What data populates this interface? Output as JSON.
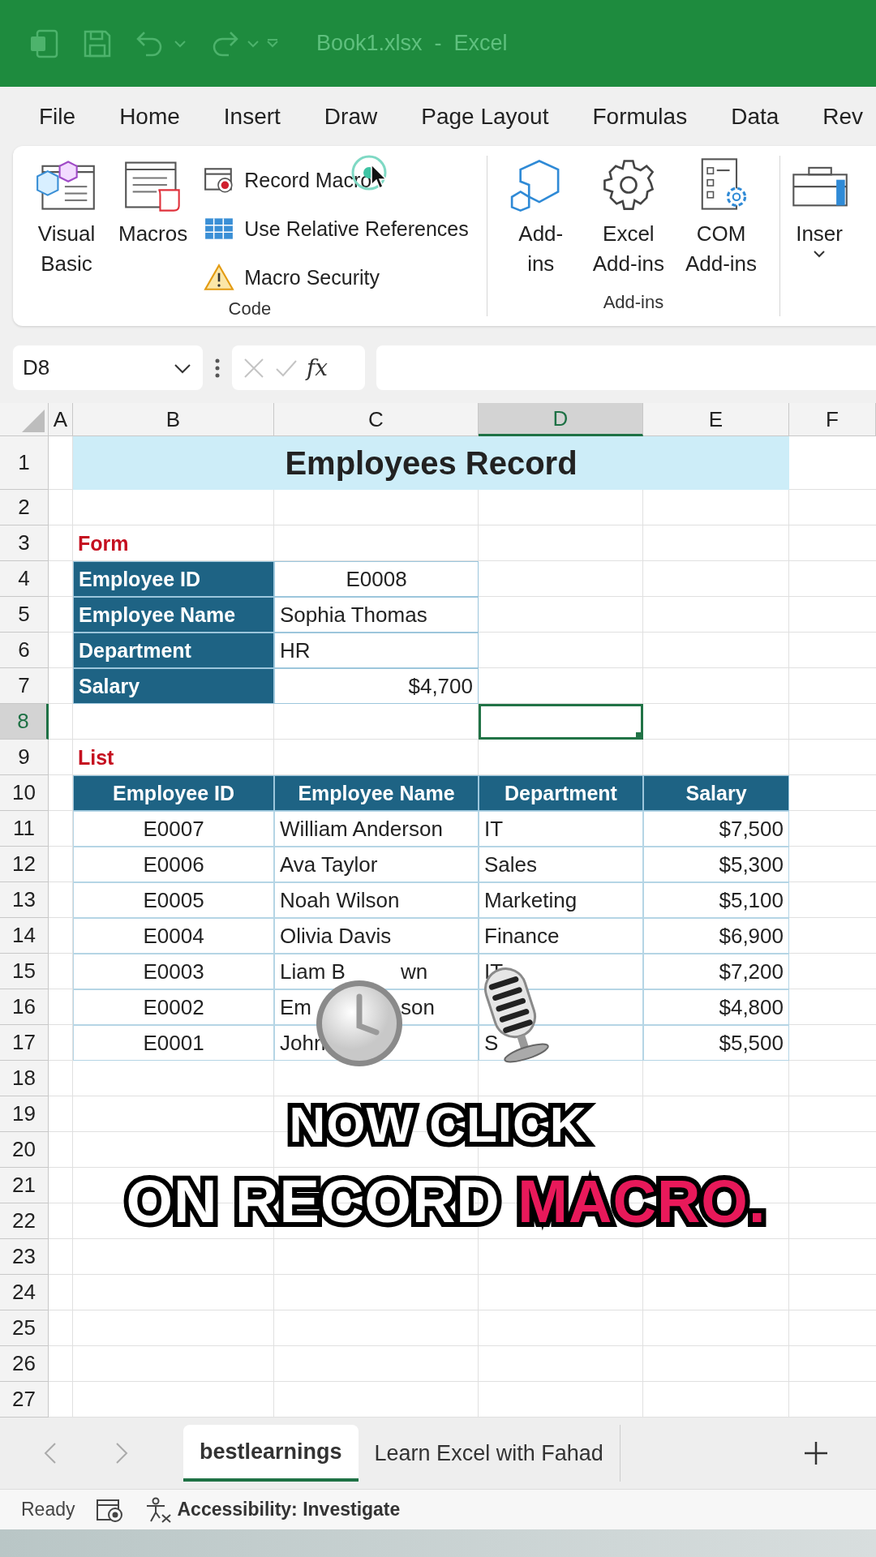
{
  "window": {
    "title": "Book1.xlsx  -  Excel"
  },
  "menu_tabs": [
    {
      "label": "File"
    },
    {
      "label": "Home"
    },
    {
      "label": "Insert"
    },
    {
      "label": "Draw"
    },
    {
      "label": "Page Layout"
    },
    {
      "label": "Formulas"
    },
    {
      "label": "Data"
    },
    {
      "label": "Rev"
    }
  ],
  "ribbon": {
    "groups": [
      {
        "label": "Code",
        "large_buttons": [
          {
            "kind": "visual-basic",
            "lines": [
              "Visual",
              "Basic"
            ]
          },
          {
            "kind": "macros",
            "lines": [
              "Macros"
            ]
          }
        ],
        "small_buttons": [
          {
            "kind": "record",
            "label": "Record Macro"
          },
          {
            "kind": "relative",
            "label": "Use Relative References"
          },
          {
            "kind": "security",
            "label": "Macro Security"
          }
        ]
      },
      {
        "label": "Add-ins",
        "large_buttons": [
          {
            "kind": "addins",
            "lines": [
              "Add-",
              "ins"
            ]
          },
          {
            "kind": "excel-addins",
            "lines": [
              "Excel",
              "Add-ins"
            ]
          },
          {
            "kind": "com-addins",
            "lines": [
              "COM",
              "Add-ins"
            ]
          }
        ]
      },
      {
        "large_buttons": [
          {
            "kind": "insert",
            "lines": [
              "Inser"
            ],
            "caret": true
          }
        ]
      }
    ]
  },
  "formula_bar": {
    "name_box": "D8",
    "function_button": "fx"
  },
  "sheet": {
    "columns": [
      {
        "label": "A",
        "selected": false
      },
      {
        "label": "B",
        "selected": false
      },
      {
        "label": "C",
        "selected": false
      },
      {
        "label": "D",
        "selected": true
      },
      {
        "label": "E",
        "selected": false
      },
      {
        "label": "F",
        "selected": false
      }
    ],
    "rows": [
      {
        "label": "1",
        "selected": false
      },
      {
        "label": "2",
        "selected": false
      },
      {
        "label": "3",
        "selected": false
      },
      {
        "label": "4",
        "selected": false
      },
      {
        "label": "5",
        "selected": false
      },
      {
        "label": "6",
        "selected": false
      },
      {
        "label": "7",
        "selected": false
      },
      {
        "label": "8",
        "selected": true
      },
      {
        "label": "9",
        "selected": false
      },
      {
        "label": "10",
        "selected": false
      },
      {
        "label": "11",
        "selected": false
      },
      {
        "label": "12",
        "selected": false
      },
      {
        "label": "13",
        "selected": false
      },
      {
        "label": "14",
        "selected": false
      },
      {
        "label": "15",
        "selected": false
      },
      {
        "label": "16",
        "selected": false
      },
      {
        "label": "17",
        "selected": false
      },
      {
        "label": "18",
        "selected": false
      },
      {
        "label": "19",
        "selected": false
      },
      {
        "label": "20",
        "selected": false
      },
      {
        "label": "21",
        "selected": false
      },
      {
        "label": "22",
        "selected": false
      },
      {
        "label": "23",
        "selected": false
      },
      {
        "label": "24",
        "selected": false
      },
      {
        "label": "25",
        "selected": false
      },
      {
        "label": "26",
        "selected": false
      },
      {
        "label": "27",
        "selected": false
      }
    ],
    "title": "Employees Record",
    "form": {
      "label": "Form",
      "fields": [
        {
          "name": "Employee ID",
          "value": "E0008",
          "kind": "id"
        },
        {
          "name": "Employee Name",
          "value": "Sophia Thomas",
          "kind": "text"
        },
        {
          "name": "Department",
          "value": "HR",
          "kind": "text"
        },
        {
          "name": "Salary",
          "value": "$4,700",
          "kind": "currency"
        }
      ]
    },
    "list": {
      "label": "List",
      "columns": [
        {
          "label": "Employee ID",
          "kind": "id"
        },
        {
          "label": "Employee Name",
          "kind": "text"
        },
        {
          "label": "Department",
          "kind": "text"
        },
        {
          "label": "Salary",
          "kind": "currency"
        }
      ],
      "rows": [
        {
          "cells": [
            "E0007",
            "William Anderson",
            "IT",
            "$7,500"
          ]
        },
        {
          "cells": [
            "E0006",
            "Ava Taylor",
            "Sales",
            "$5,300"
          ]
        },
        {
          "cells": [
            "E0005",
            "Noah Wilson",
            "Marketing",
            "$5,100"
          ]
        },
        {
          "cells": [
            "E0004",
            "Olivia Davis",
            "Finance",
            "$6,900"
          ]
        },
        {
          "cells": [
            "E0003",
            {
              "text": "Liam B",
              "tail": "wn"
            },
            "IT",
            "$7,200"
          ]
        },
        {
          "cells": [
            "E0002",
            {
              "text": "Em",
              "tail": "son"
            },
            null,
            "$4,800"
          ]
        },
        {
          "cells": [
            "E0001",
            "John",
            "S",
            "$5,500"
          ]
        }
      ]
    }
  },
  "caption": {
    "lines": [
      {
        "segments": [
          {
            "text": "NOW CLICK",
            "highlight": false
          }
        ]
      },
      {
        "segments": [
          {
            "text": "ON RECORD",
            "highlight": false
          },
          {
            "text": "MACRO.",
            "highlight": true
          }
        ]
      }
    ]
  },
  "sheet_tabs": [
    {
      "label": "bestlearnings",
      "selected": true
    },
    {
      "label": "Learn Excel with Fahad",
      "selected": false
    }
  ],
  "status_bar": {
    "mode": "Ready",
    "accessibility": "Accessibility: Investigate"
  }
}
